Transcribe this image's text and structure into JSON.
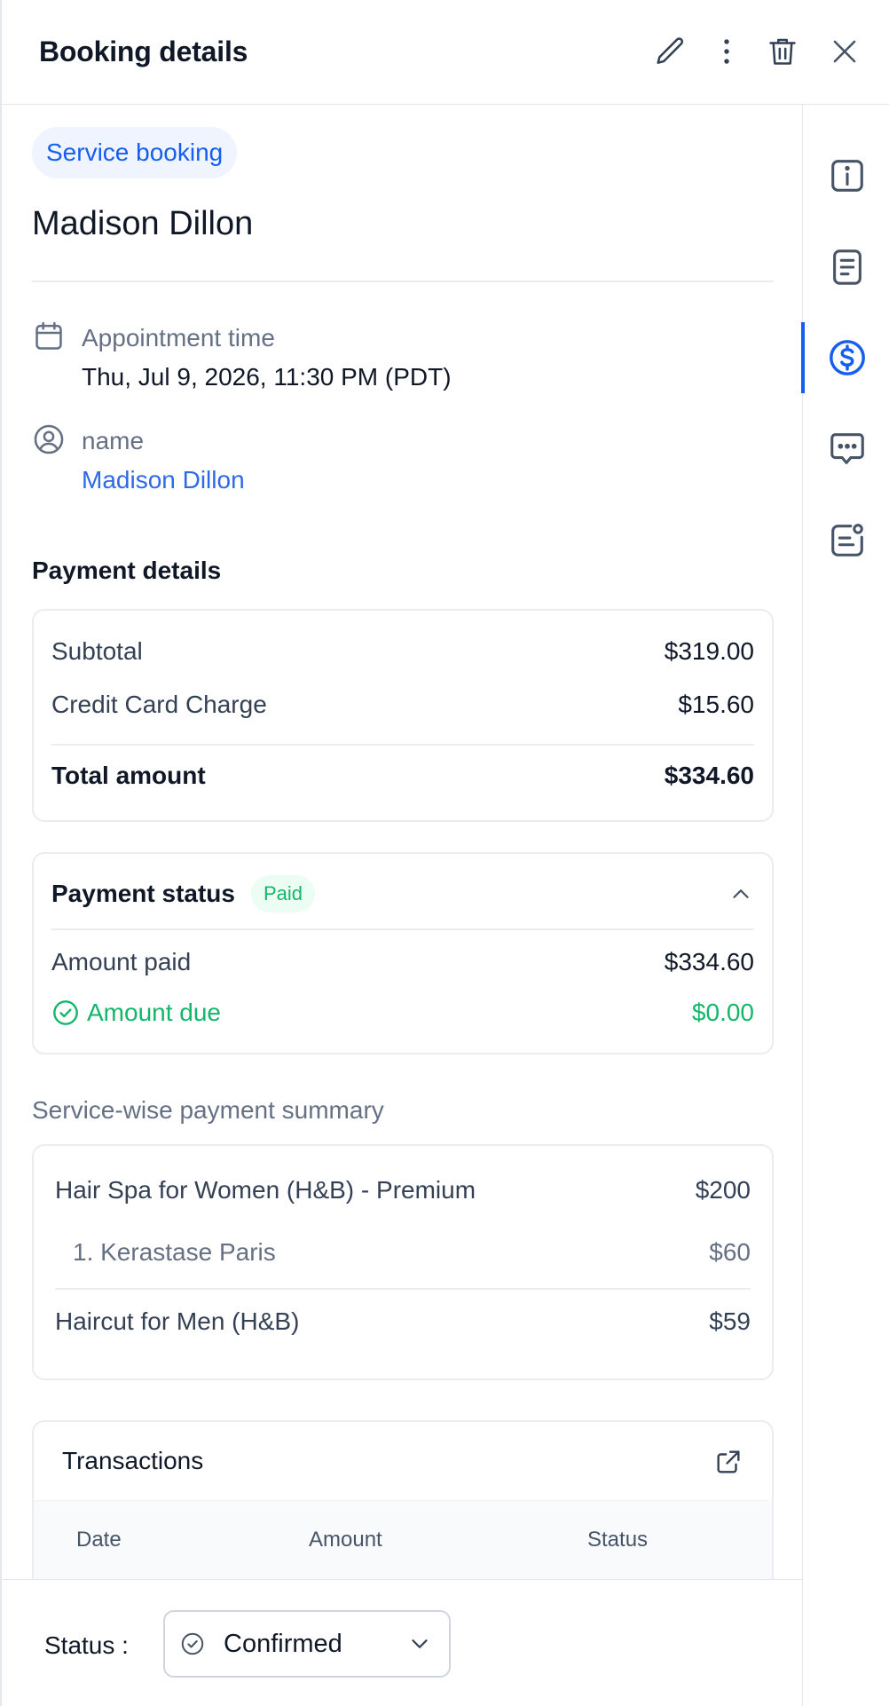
{
  "header": {
    "title": "Booking details"
  },
  "booking": {
    "type_chip": "Service booking",
    "customer_name": "Madison Dillon",
    "appointment_label": "Appointment time",
    "appointment_value": "Thu, Jul 9, 2026, 11:30 PM (PDT)",
    "name_label": "name",
    "name_value": "Madison Dillon"
  },
  "payment": {
    "title": "Payment details",
    "subtotal_label": "Subtotal",
    "subtotal_value": "$319.00",
    "cc_label": "Credit Card Charge",
    "cc_value": "$15.60",
    "total_label": "Total amount",
    "total_value": "$334.60"
  },
  "payment_status": {
    "label": "Payment status",
    "badge": "Paid",
    "amount_paid_label": "Amount paid",
    "amount_paid_value": "$334.60",
    "amount_due_label": "Amount due",
    "amount_due_value": "$0.00"
  },
  "service_summary": {
    "title": "Service-wise payment summary",
    "items": [
      {
        "name": "Hair Spa for Women (H&B) - Premium",
        "price": "$200"
      },
      {
        "name": "1. Kerastase Paris",
        "price": "$60"
      },
      {
        "name": "Haircut for Men (H&B)",
        "price": "$59"
      }
    ]
  },
  "transactions": {
    "title": "Transactions",
    "columns": [
      "Date",
      "Amount",
      "Status"
    ]
  },
  "footer": {
    "status_label": "Status :",
    "status_value": "Confirmed"
  },
  "rail": [
    "info-icon",
    "document-icon",
    "dollar-icon",
    "chat-icon",
    "notes-icon"
  ],
  "colors": {
    "accent": "#155eef",
    "link": "#2e6ae6",
    "success": "#12b76a"
  }
}
